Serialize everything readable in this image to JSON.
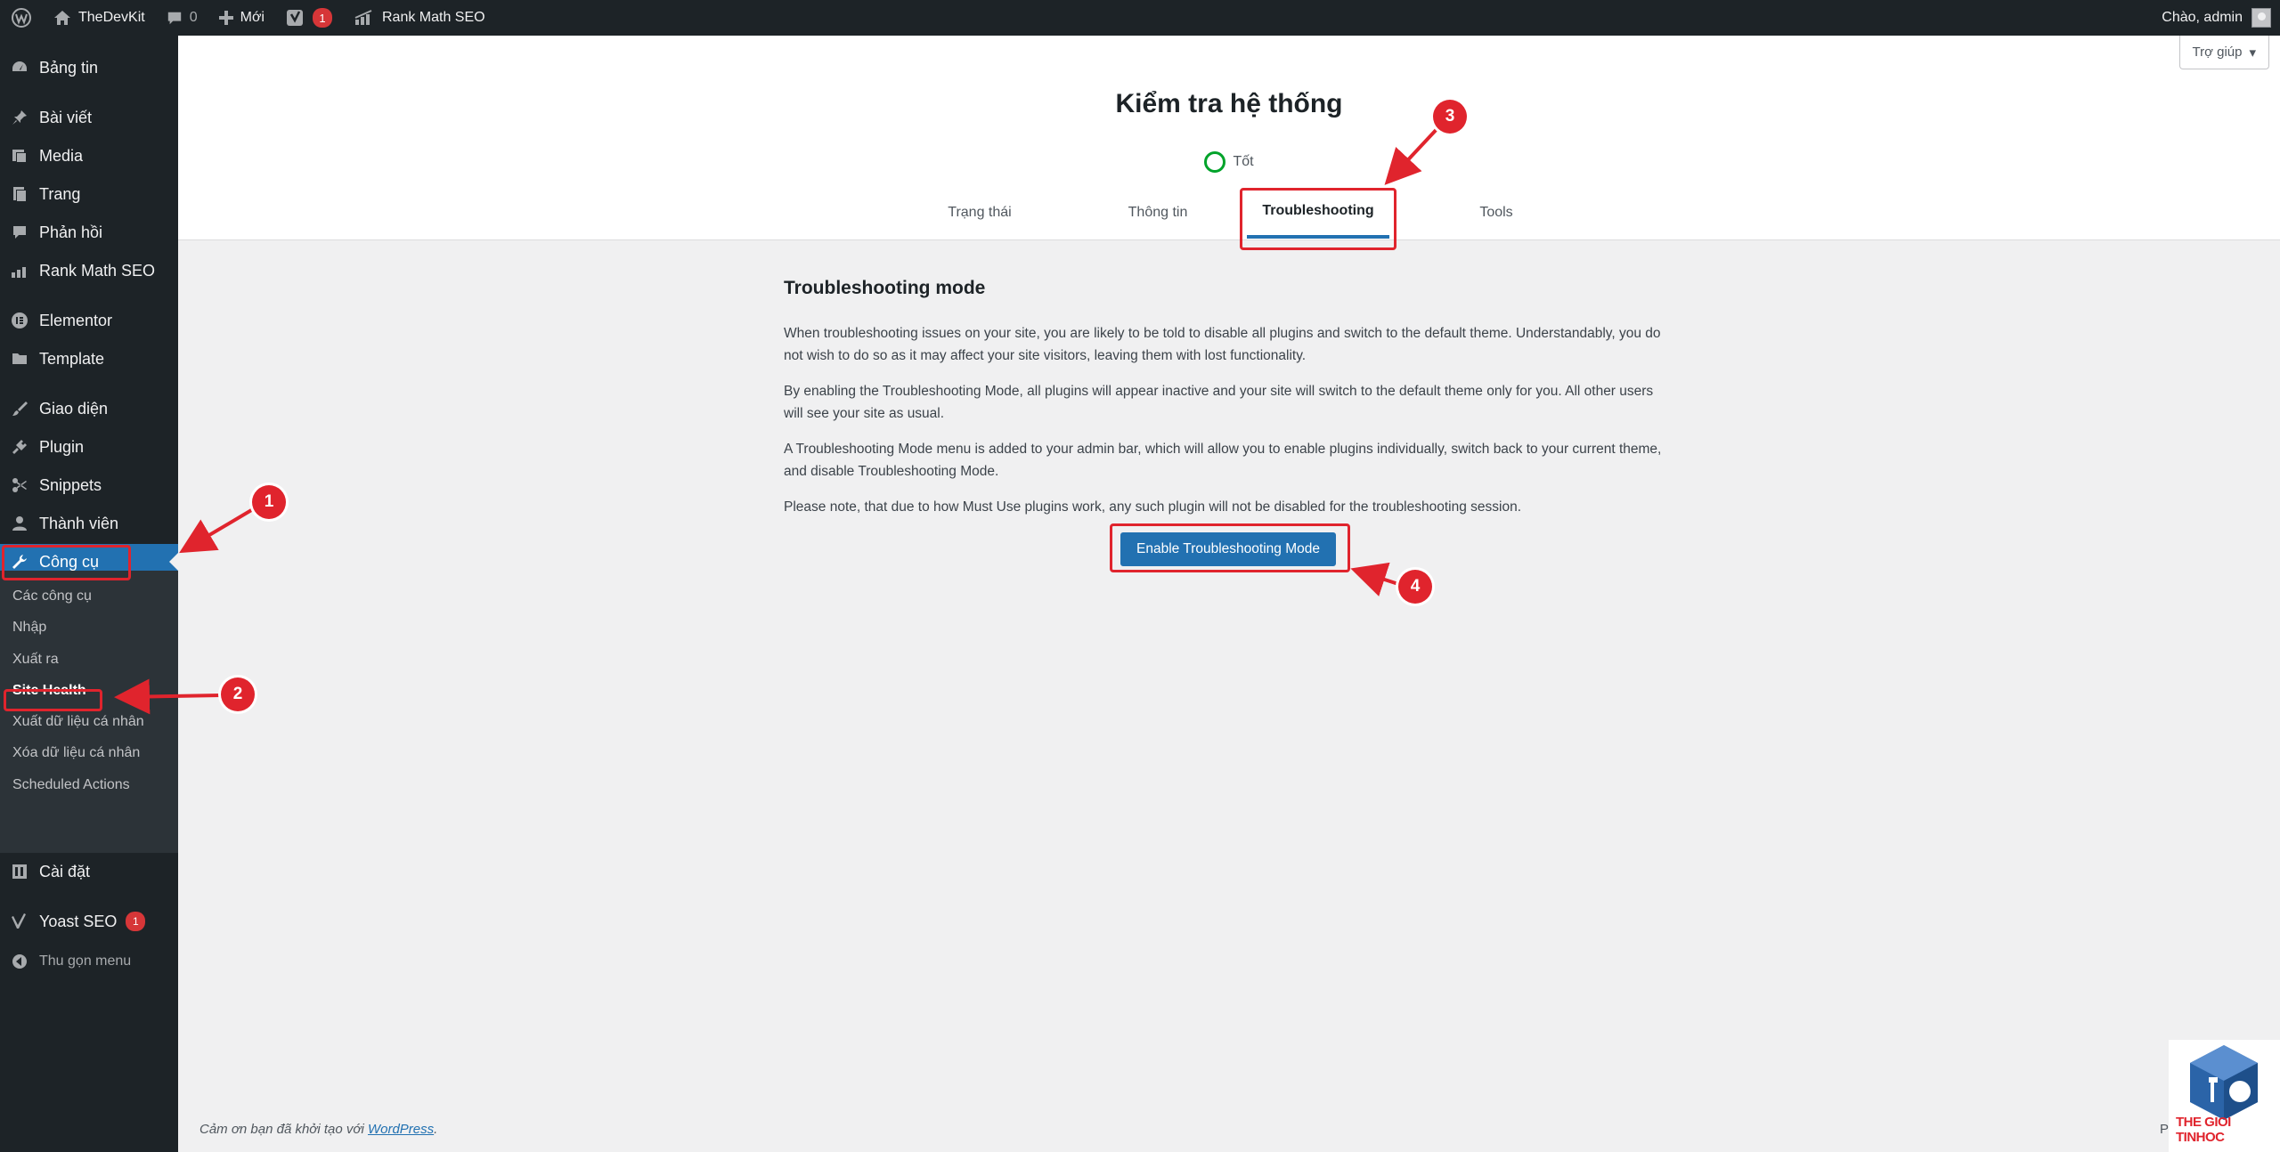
{
  "adminbar": {
    "site_name": "TheDevKit",
    "comments_count": "0",
    "new_label": "Mới",
    "yoast_badge": "1",
    "rankmath_label": "Rank Math SEO",
    "greeting": "Chào, admin"
  },
  "sidebar": {
    "items": [
      {
        "label": "Bảng tin",
        "icon": "dashboard-icon"
      },
      {
        "label": "Bài viết",
        "icon": "pin-icon"
      },
      {
        "label": "Media",
        "icon": "media-icon"
      },
      {
        "label": "Trang",
        "icon": "page-icon"
      },
      {
        "label": "Phản hồi",
        "icon": "comment-icon"
      },
      {
        "label": "Rank Math SEO",
        "icon": "rankmath-icon"
      },
      {
        "label": "Elementor",
        "icon": "elementor-icon"
      },
      {
        "label": "Template",
        "icon": "folder-icon"
      },
      {
        "label": "Giao diện",
        "icon": "brush-icon"
      },
      {
        "label": "Plugin",
        "icon": "plugin-icon"
      },
      {
        "label": "Snippets",
        "icon": "scissors-icon"
      },
      {
        "label": "Thành viên",
        "icon": "user-icon"
      },
      {
        "label": "Công cụ",
        "icon": "wrench-icon"
      },
      {
        "label": "Cài đặt",
        "icon": "settings-icon"
      },
      {
        "label": "Yoast SEO",
        "icon": "yoast-icon",
        "badge": "1"
      }
    ],
    "submenu": [
      "Các công cụ",
      "Nhập",
      "Xuất ra",
      "Site Health",
      "Xuất dữ liệu cá nhân",
      "Xóa dữ liệu cá nhân",
      "Scheduled Actions"
    ],
    "collapse_label": "Thu gọn menu"
  },
  "header": {
    "help_label": "Trợ giúp",
    "title": "Kiểm tra hệ thống",
    "status": "Tốt",
    "tabs": [
      "Trạng thái",
      "Thông tin",
      "Troubleshooting",
      "Tools"
    ]
  },
  "main": {
    "section_title": "Troubleshooting mode",
    "paragraphs": [
      "When troubleshooting issues on your site, you are likely to be told to disable all plugins and switch to the default theme. Understandably, you do not wish to do so as it may affect your site visitors, leaving them with lost functionality.",
      "By enabling the Troubleshooting Mode, all plugins will appear inactive and your site will switch to the default theme only for you. All other users will see your site as usual.",
      "A Troubleshooting Mode menu is added to your admin bar, which will allow you to enable plugins individually, switch back to your current theme, and disable Troubleshooting Mode.",
      "Please note, that due to how Must Use plugins work, any such plugin will not be disabled for the troubleshooting session."
    ],
    "button_label": "Enable Troubleshooting Mode"
  },
  "footer": {
    "text": "Cảm ơn bạn đã khởi tạo với",
    "link": "WordPress",
    "end": ".",
    "version_fragment": "P"
  },
  "annotations": [
    "1",
    "2",
    "3",
    "4"
  ],
  "watermark": {
    "text": "THE GIOI TINHOC"
  },
  "colors": {
    "admin_dark": "#1d2327",
    "accent_blue": "#2271b1",
    "annotation_red": "#e0242d",
    "status_green": "#00a32a"
  }
}
